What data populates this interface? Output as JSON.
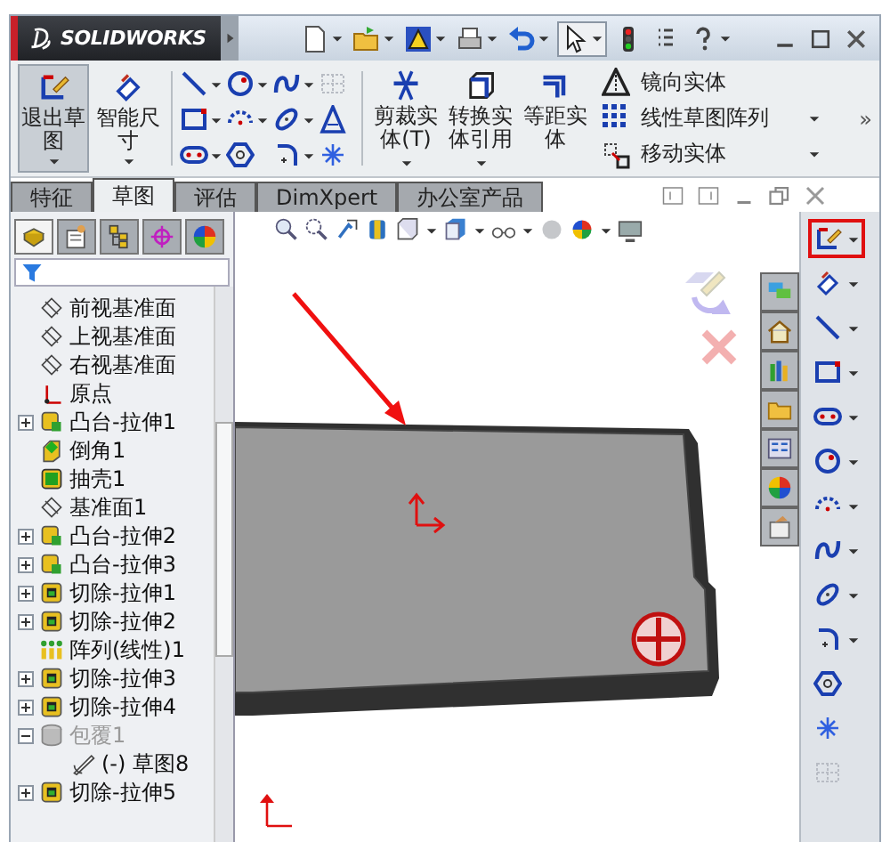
{
  "app": {
    "brand": "SOLIDWORKS"
  },
  "ribbon": {
    "large_buttons": [
      {
        "label": "退出草图",
        "kind": "exit-sketch",
        "selected": true
      },
      {
        "label": "智能尺寸",
        "kind": "dimension",
        "selected": false
      }
    ],
    "tool_buttons": [
      {
        "label": "剪裁实体(T)",
        "kind": "trim"
      },
      {
        "label": "转换实体引用",
        "kind": "convert"
      },
      {
        "label": "等距实体",
        "kind": "offset"
      }
    ],
    "list_buttons": [
      {
        "label": "镜向实体",
        "kind": "mirror"
      },
      {
        "label": "线性草图阵列",
        "kind": "pattern"
      },
      {
        "label": "移动实体",
        "kind": "move"
      }
    ],
    "overflow": "»"
  },
  "tabs": [
    {
      "label": "特征",
      "selected": false
    },
    {
      "label": "草图",
      "selected": true
    },
    {
      "label": "评估",
      "selected": false
    },
    {
      "label": "DimXpert",
      "selected": false
    },
    {
      "label": "办公室产品",
      "selected": false
    }
  ],
  "feature_tree": {
    "items": [
      {
        "label": "前视基准面",
        "kind": "plane",
        "dimmed": false
      },
      {
        "label": "上视基准面",
        "kind": "plane",
        "dimmed": false
      },
      {
        "label": "右视基准面",
        "kind": "plane",
        "dimmed": false
      },
      {
        "label": "原点",
        "kind": "origin",
        "dimmed": false
      },
      {
        "label": "凸台-拉伸1",
        "kind": "boss",
        "dimmed": false,
        "expanded": false
      },
      {
        "label": "倒角1",
        "kind": "chamfer",
        "dimmed": false
      },
      {
        "label": "抽壳1",
        "kind": "shell",
        "dimmed": false
      },
      {
        "label": "基准面1",
        "kind": "plane",
        "dimmed": false
      },
      {
        "label": "凸台-拉伸2",
        "kind": "boss",
        "dimmed": false,
        "expanded": false
      },
      {
        "label": "凸台-拉伸3",
        "kind": "boss",
        "dimmed": false,
        "expanded": false
      },
      {
        "label": "切除-拉伸1",
        "kind": "cut",
        "dimmed": false,
        "expanded": false
      },
      {
        "label": "切除-拉伸2",
        "kind": "cut",
        "dimmed": false,
        "expanded": false
      },
      {
        "label": "阵列(线性)1",
        "kind": "pattern",
        "dimmed": false
      },
      {
        "label": "切除-拉伸3",
        "kind": "cut",
        "dimmed": false,
        "expanded": false
      },
      {
        "label": "切除-拉伸4",
        "kind": "cut",
        "dimmed": false,
        "expanded": false
      },
      {
        "label": "包覆1",
        "kind": "wrap",
        "dimmed": true,
        "expanded": true,
        "children": [
          {
            "label": "(-) 草图8",
            "kind": "sketch",
            "dimmed": false
          }
        ]
      },
      {
        "label": "切除-拉伸5",
        "kind": "cut",
        "dimmed": false,
        "expanded": false
      }
    ]
  },
  "sketch_toolbar": {
    "tools": [
      {
        "kind": "sketch",
        "highlighted": true
      },
      {
        "kind": "dimension",
        "highlighted": false
      },
      {
        "kind": "line",
        "highlighted": false
      },
      {
        "kind": "rect",
        "highlighted": false
      },
      {
        "kind": "slot",
        "highlighted": false
      },
      {
        "kind": "circle",
        "highlighted": false
      },
      {
        "kind": "arc",
        "highlighted": false
      },
      {
        "kind": "spline",
        "highlighted": false
      },
      {
        "kind": "ellipse",
        "highlighted": false
      },
      {
        "kind": "fillet",
        "highlighted": false
      },
      {
        "kind": "polygon",
        "highlighted": false
      },
      {
        "kind": "point",
        "highlighted": false
      },
      {
        "kind": "grid",
        "highlighted": false
      }
    ]
  }
}
